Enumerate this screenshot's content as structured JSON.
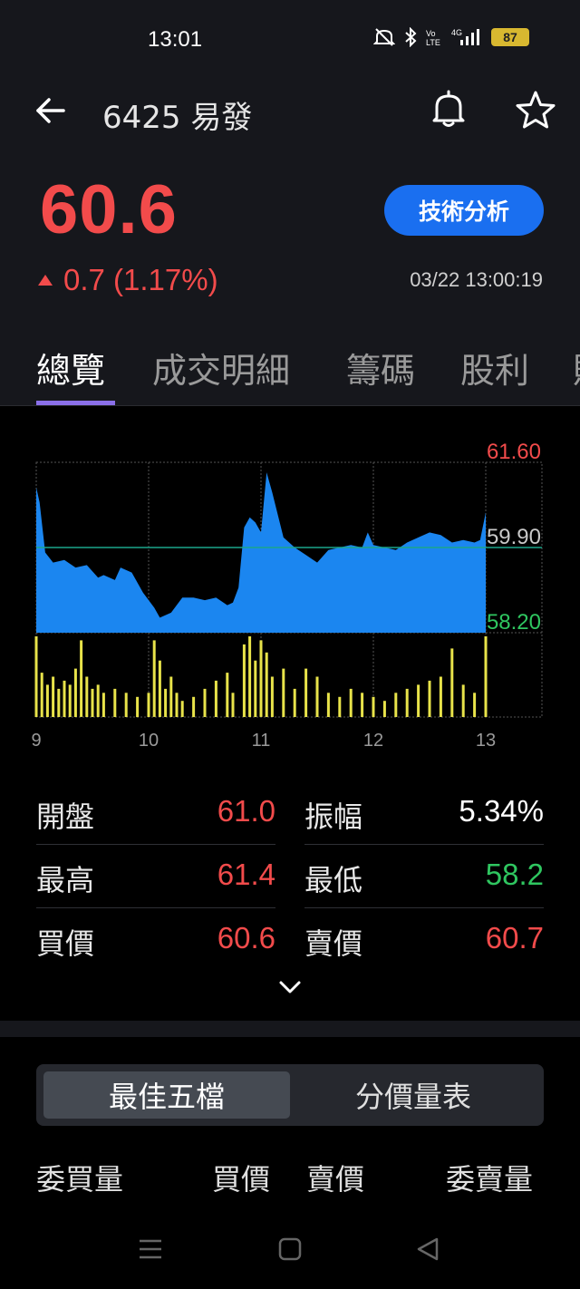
{
  "status_bar": {
    "time": "13:01",
    "battery": "87",
    "icons": [
      "mute-icon",
      "bluetooth-icon",
      "volte-icon",
      "signal-4g-icon",
      "battery-icon"
    ]
  },
  "header": {
    "title": "6425 易發",
    "icons": [
      "back-arrow-icon",
      "bell-icon",
      "star-icon"
    ]
  },
  "quote": {
    "price": "60.6",
    "change": "0.7 (1.17%)",
    "timestamp": "03/22 13:00:19",
    "tech_button": "技術分析",
    "up_color": "#f24b4b"
  },
  "tabs": [
    {
      "label": "總覽",
      "active": true
    },
    {
      "label": "成交明細",
      "active": false
    },
    {
      "label": "籌碼",
      "active": false
    },
    {
      "label": "股利",
      "active": false
    },
    {
      "label": "財",
      "active": false
    }
  ],
  "chart_data": {
    "type": "area",
    "y_labels": {
      "high": "61.60",
      "ref": "59.90",
      "low": "58.20"
    },
    "ylim": [
      58.2,
      61.6
    ],
    "reference": 59.9,
    "x_ticks": [
      "9",
      "10",
      "11",
      "12",
      "13"
    ],
    "price_series": [
      [
        9.0,
        61.1
      ],
      [
        9.03,
        60.8
      ],
      [
        9.08,
        59.8
      ],
      [
        9.15,
        59.6
      ],
      [
        9.25,
        59.65
      ],
      [
        9.35,
        59.5
      ],
      [
        9.45,
        59.55
      ],
      [
        9.55,
        59.3
      ],
      [
        9.6,
        59.35
      ],
      [
        9.7,
        59.25
      ],
      [
        9.75,
        59.5
      ],
      [
        9.85,
        59.4
      ],
      [
        9.95,
        59.0
      ],
      [
        10.05,
        58.7
      ],
      [
        10.1,
        58.5
      ],
      [
        10.2,
        58.6
      ],
      [
        10.3,
        58.9
      ],
      [
        10.4,
        58.9
      ],
      [
        10.5,
        58.85
      ],
      [
        10.6,
        58.9
      ],
      [
        10.7,
        58.75
      ],
      [
        10.75,
        58.8
      ],
      [
        10.8,
        59.1
      ],
      [
        10.85,
        60.3
      ],
      [
        10.9,
        60.5
      ],
      [
        10.95,
        60.4
      ],
      [
        11.0,
        60.2
      ],
      [
        11.05,
        61.4
      ],
      [
        11.1,
        61.0
      ],
      [
        11.2,
        60.1
      ],
      [
        11.3,
        59.9
      ],
      [
        11.4,
        59.75
      ],
      [
        11.5,
        59.6
      ],
      [
        11.6,
        59.85
      ],
      [
        11.7,
        59.9
      ],
      [
        11.8,
        59.95
      ],
      [
        11.9,
        59.9
      ],
      [
        11.95,
        60.2
      ],
      [
        12.0,
        59.95
      ],
      [
        12.1,
        59.9
      ],
      [
        12.2,
        59.85
      ],
      [
        12.3,
        60.0
      ],
      [
        12.4,
        60.1
      ],
      [
        12.5,
        60.2
      ],
      [
        12.6,
        60.15
      ],
      [
        12.7,
        60.0
      ],
      [
        12.8,
        60.05
      ],
      [
        12.9,
        60.0
      ],
      [
        12.95,
        60.05
      ],
      [
        13.0,
        60.6
      ]
    ],
    "volume_series": [
      [
        9.0,
        1.0
      ],
      [
        9.05,
        0.55
      ],
      [
        9.1,
        0.4
      ],
      [
        9.15,
        0.5
      ],
      [
        9.2,
        0.35
      ],
      [
        9.25,
        0.45
      ],
      [
        9.3,
        0.4
      ],
      [
        9.35,
        0.6
      ],
      [
        9.4,
        0.95
      ],
      [
        9.45,
        0.5
      ],
      [
        9.5,
        0.35
      ],
      [
        9.55,
        0.4
      ],
      [
        9.6,
        0.3
      ],
      [
        9.7,
        0.35
      ],
      [
        9.8,
        0.3
      ],
      [
        9.9,
        0.25
      ],
      [
        10.0,
        0.3
      ],
      [
        10.05,
        0.95
      ],
      [
        10.1,
        0.7
      ],
      [
        10.15,
        0.35
      ],
      [
        10.2,
        0.5
      ],
      [
        10.25,
        0.3
      ],
      [
        10.3,
        0.2
      ],
      [
        10.4,
        0.25
      ],
      [
        10.5,
        0.35
      ],
      [
        10.6,
        0.45
      ],
      [
        10.7,
        0.55
      ],
      [
        10.75,
        0.3
      ],
      [
        10.85,
        0.9
      ],
      [
        10.9,
        1.0
      ],
      [
        10.95,
        0.7
      ],
      [
        11.0,
        0.95
      ],
      [
        11.05,
        0.8
      ],
      [
        11.1,
        0.5
      ],
      [
        11.2,
        0.6
      ],
      [
        11.3,
        0.35
      ],
      [
        11.4,
        0.6
      ],
      [
        11.5,
        0.5
      ],
      [
        11.6,
        0.3
      ],
      [
        11.7,
        0.25
      ],
      [
        11.8,
        0.35
      ],
      [
        11.9,
        0.3
      ],
      [
        12.0,
        0.25
      ],
      [
        12.1,
        0.2
      ],
      [
        12.2,
        0.3
      ],
      [
        12.3,
        0.35
      ],
      [
        12.4,
        0.4
      ],
      [
        12.5,
        0.45
      ],
      [
        12.6,
        0.5
      ],
      [
        12.7,
        0.85
      ],
      [
        12.8,
        0.4
      ],
      [
        12.9,
        0.3
      ],
      [
        13.0,
        1.0
      ]
    ],
    "colors": {
      "area": "#1b86f0",
      "volume": "#e8e34a",
      "ref_line": "#1aa58a",
      "grid": "#555555",
      "axis_label": "#9a9a9a"
    }
  },
  "stats": {
    "left": [
      {
        "label": "開盤",
        "value": "61.0",
        "color": "red"
      },
      {
        "label": "最高",
        "value": "61.4",
        "color": "red"
      },
      {
        "label": "買價",
        "value": "60.6",
        "color": "red"
      }
    ],
    "right": [
      {
        "label": "振幅",
        "value": "5.34%",
        "color": "white"
      },
      {
        "label": "最低",
        "value": "58.2",
        "color": "green"
      },
      {
        "label": "賣價",
        "value": "60.7",
        "color": "red"
      }
    ]
  },
  "segments": [
    {
      "label": "最佳五檔",
      "active": true
    },
    {
      "label": "分價量表",
      "active": false
    }
  ],
  "order_book_headers": [
    "委買量",
    "買價",
    "賣價",
    "委賣量"
  ]
}
